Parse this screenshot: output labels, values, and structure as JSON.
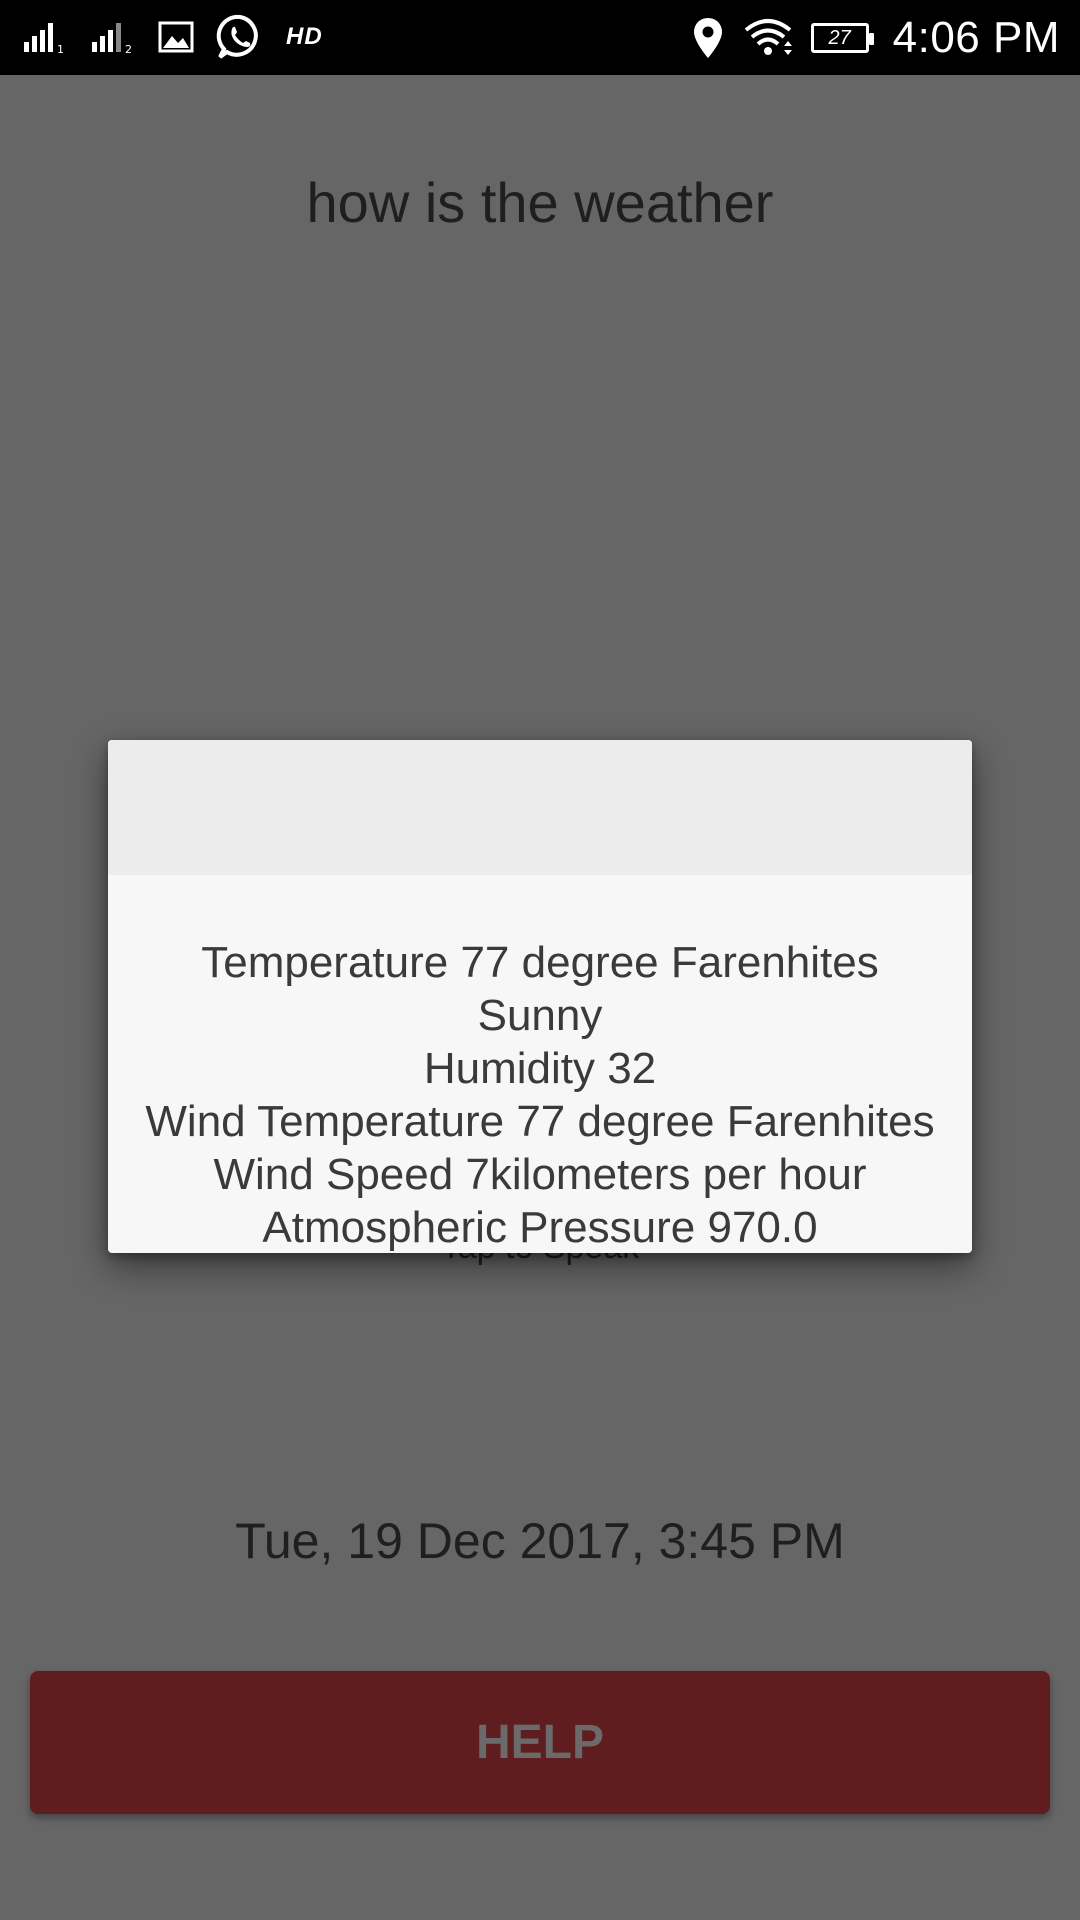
{
  "status_bar": {
    "signal_1_icon": "signal-bars-sim1-icon",
    "signal_2_icon": "signal-bars-sim2-icon",
    "gallery_icon": "image-icon",
    "whatsapp_icon": "whatsapp-icon",
    "hd_label": "HD",
    "location_icon": "location-pin-icon",
    "wifi_icon": "wifi-icon",
    "battery_level": "27",
    "time": "4:06 PM"
  },
  "main": {
    "query_text": "how is the weather",
    "tap_label": "Tap to Speak",
    "date_text": "Tue, 19 Dec 2017, 3:45 PM",
    "help_label": "HELP"
  },
  "dialog": {
    "lines": [
      "Temperature 77 degree Farenhites",
      "Sunny",
      "Humidity 32",
      "Wind Temperature 77 degree Farenhites",
      "Wind Speed 7kilometers per hour",
      "Atmospheric Pressure 970.0"
    ]
  },
  "colors": {
    "scrim": "#666666",
    "help_button": "#5f1d1f",
    "dialog_background": "#f7f7f7",
    "dialog_header": "#ececec"
  }
}
